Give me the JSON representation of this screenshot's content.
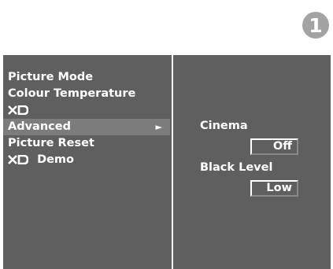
{
  "step_number": "1",
  "menu": {
    "items": [
      {
        "label": "Picture Mode"
      },
      {
        "label": "Colour Temperature"
      },
      {
        "label": "XD"
      },
      {
        "label": "Advanced",
        "selected": true,
        "arrow": "►"
      },
      {
        "label": "Picture Reset"
      },
      {
        "label": "Demo",
        "prefix": "XD"
      }
    ]
  },
  "submenu": {
    "cinema_label": "Cinema",
    "cinema_value": "Off",
    "black_level_label": "Black Level",
    "black_level_value": "Low"
  },
  "colors": {
    "panel": "#5f5f5f",
    "highlight": "#7c7c7c",
    "badge": "#a3a3a3"
  }
}
